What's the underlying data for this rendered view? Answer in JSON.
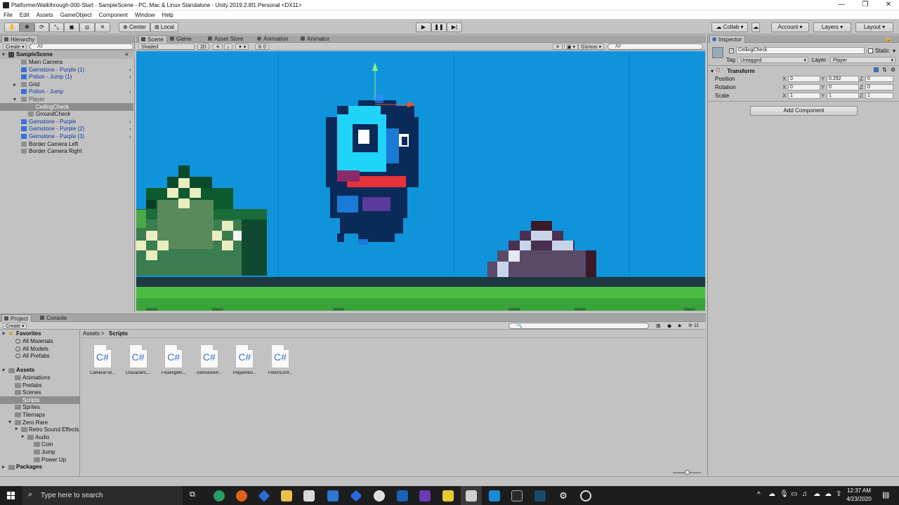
{
  "window": {
    "title": "PlatformerWalkthrough-000-Start - SampleScene - PC, Mac & Linux Standalone - Unity 2019.2.8f1 Personal <DX11>",
    "minimize": "—",
    "maximize": "❐",
    "close": "✕"
  },
  "menu": [
    "File",
    "Edit",
    "Assets",
    "GameObject",
    "Component",
    "Window",
    "Help"
  ],
  "toolbar": {
    "center_label": "Center",
    "local_label": "Local",
    "collab_label": "Collab",
    "account_label": "Account",
    "layers_label": "Layers",
    "layout_label": "Layout"
  },
  "hierarchy": {
    "tab_label": "Hierarchy",
    "create_label": "Create",
    "search_placeholder": "All",
    "scene_name": "SampleScene",
    "items": [
      {
        "label": "Main Camera",
        "kind": "object"
      },
      {
        "label": "Gemstone - Purple (1)",
        "kind": "prefab"
      },
      {
        "label": "Potion - Jump (1)",
        "kind": "prefab"
      },
      {
        "label": "Grid",
        "kind": "object"
      },
      {
        "label": "Potion - Jump",
        "kind": "prefab"
      },
      {
        "label": "Player",
        "kind": "object-dim"
      },
      {
        "label": "CeilingCheck",
        "kind": "child-selected"
      },
      {
        "label": "GroundCheck",
        "kind": "child"
      },
      {
        "label": "Gemstone - Purple",
        "kind": "prefab"
      },
      {
        "label": "Gemstone - Purple (2)",
        "kind": "prefab"
      },
      {
        "label": "Gemstone - Purple (3)",
        "kind": "prefab"
      },
      {
        "label": "Border Camera Left",
        "kind": "object"
      },
      {
        "label": "Border Camera Right",
        "kind": "object"
      }
    ]
  },
  "scene_view": {
    "tabs": [
      "Scene",
      "Game",
      "Asset Store",
      "Animation",
      "Animator"
    ],
    "shading_mode": "Shaded",
    "mode_2d": "2D",
    "hidden_count": "0",
    "gizmos_label": "Gizmos",
    "search_placeholder": "All"
  },
  "project": {
    "tabs": [
      "Project",
      "Console"
    ],
    "create_label": "Create",
    "favorites_label": "Favorites",
    "favorites": [
      "All Materials",
      "All Models",
      "All Prefabs"
    ],
    "assets_label": "Assets",
    "folders": [
      "Animations",
      "Prefabs",
      "Scenes",
      "Scripts",
      "Sprites",
      "Tilemaps",
      "Zero Rare",
      "Retro Sound Effects",
      "Audio",
      "Coin",
      "Jump",
      "Power Up"
    ],
    "packages_label": "Packages",
    "breadcrumb": [
      "Assets",
      "Scripts"
    ],
    "breadcrumb_sep": ">",
    "hidden_count": "11",
    "script_badge": "C#",
    "scripts": [
      "CameraFoll...",
      "CharacterC...",
      "FloatingMo...",
      "GemstoneP...",
      "PlayerMov...",
      "PotionCont..."
    ]
  },
  "inspector": {
    "tab_label": "Inspector",
    "object_name": "CeilingCheck",
    "static_label": "Static",
    "tag_label": "Tag",
    "tag_value": "Untagged",
    "layer_label": "Layer",
    "layer_value": "Player",
    "component_title": "Transform",
    "axis_labels": [
      "X",
      "Y",
      "Z"
    ],
    "position_label": "Position",
    "position": [
      "0",
      "0.292",
      "0"
    ],
    "rotation_label": "Rotation",
    "rotation": [
      "0",
      "0",
      "0"
    ],
    "scale_label": "Scale",
    "scale": [
      "1",
      "1",
      "1"
    ],
    "add_component_label": "Add Component"
  },
  "taskbar": {
    "search_placeholder": "Type here to search",
    "time": "12:37 AM",
    "date": "4/23/2020"
  }
}
